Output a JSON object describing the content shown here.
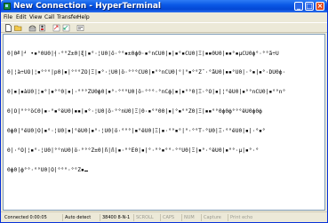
{
  "window": {
    "title": "New Connection - HyperTerminal",
    "minimize_glyph": "_",
    "maximize_glyph": "□",
    "close_glyph": "×"
  },
  "menu": [
    {
      "label": "File"
    },
    {
      "label": "Edit"
    },
    {
      "label": "View"
    },
    {
      "label": "Call"
    },
    {
      "label": "Transfer"
    },
    {
      "label": "Help"
    }
  ],
  "toolbar": [
    {
      "icon": "new-document-icon"
    },
    {
      "icon": "open-folder-icon"
    },
    {
      "icon": "connect-phone-icon"
    },
    {
      "icon": "disconnect-phone-icon"
    },
    {
      "icon": "send-file-icon"
    },
    {
      "icon": "receive-file-icon"
    },
    {
      "icon": "properties-icon"
    }
  ],
  "terminal": {
    "lines": [
      "0|0╝|┘ •▪°0U0|┤·°°Z±0|ξ|▪°·¦U0|ö·°°▪±0ф0·▪°nCU0|▪|▪°▪CU0|Ξ|▪▪0U0|▪▪°▪µCU0ф°·°°ã÷U",
      "0|¦à÷UÖ|¦▪°°°|p0|▪|°°°ZÖ|Ξ|▪°·¦U0|ö·°°°CU0|▪°°nCU0|°|°▪°°Z¯·°ãU0|▪▪°U0|·°▪|▪°·DU0ф·",
      "0|▪|▪àU0|¦▪°|▪°°0|▪|·°°°ZU0ф0|▪°·°°°U0|ö·°°°·°nCф|▪|▪°°0|Ξ·°Ö|▪|¦°ёU0|▪°°nCU0|▪°°n°",
      "0|Ö|°°°öC0|▪·°▪°ёU0|▪▪|▪°·¦U0|ö·°°nU0|Ξ|0·▪°°00|▪|°▪°°Z0|Ξ|▪▪°°0ф0ф°°°ёU0ф0ф",
      "0ф0|°ёU0|Ö|▪°·¦U0|▪|°ёU0|▪°·¦U0|ö·°°°|▪°ёU0|Ξ|▪·°°▪°|°·°°T·°U0|Ξ·°°ёU0|▪|·°▪°",
      "0|·°Ö|¦▪°·¦U0|°°nU0|ö·°°°Z±0|ñ|ñ|▪·°°Ё0|▪|°·°°▪°°·°°U0|Ξ|▪°·°ёU0|▪°°·µ|▪°·°",
      "0ф0|ф°°·°°U0|Ö|°°°·°°Z▪",
      "",
      "",
      "",
      "",
      "",
      "",
      "",
      "",
      "",
      "",
      "",
      "",
      "",
      "",
      "",
      "",
      "",
      ""
    ]
  },
  "status": {
    "connected": "Connected 0:00:05",
    "detect": "Auto detect",
    "baud": "38400 8-N-1",
    "scroll": "SCROLL",
    "caps": "CAPS",
    "num": "NUM",
    "capture": "Capture",
    "print_echo": "Print echo"
  },
  "colors": {
    "titlebar": "#0a58e6",
    "close_button": "#e04b1d",
    "terminal_bg": "#ffffff",
    "chrome": "#ece9d8"
  }
}
